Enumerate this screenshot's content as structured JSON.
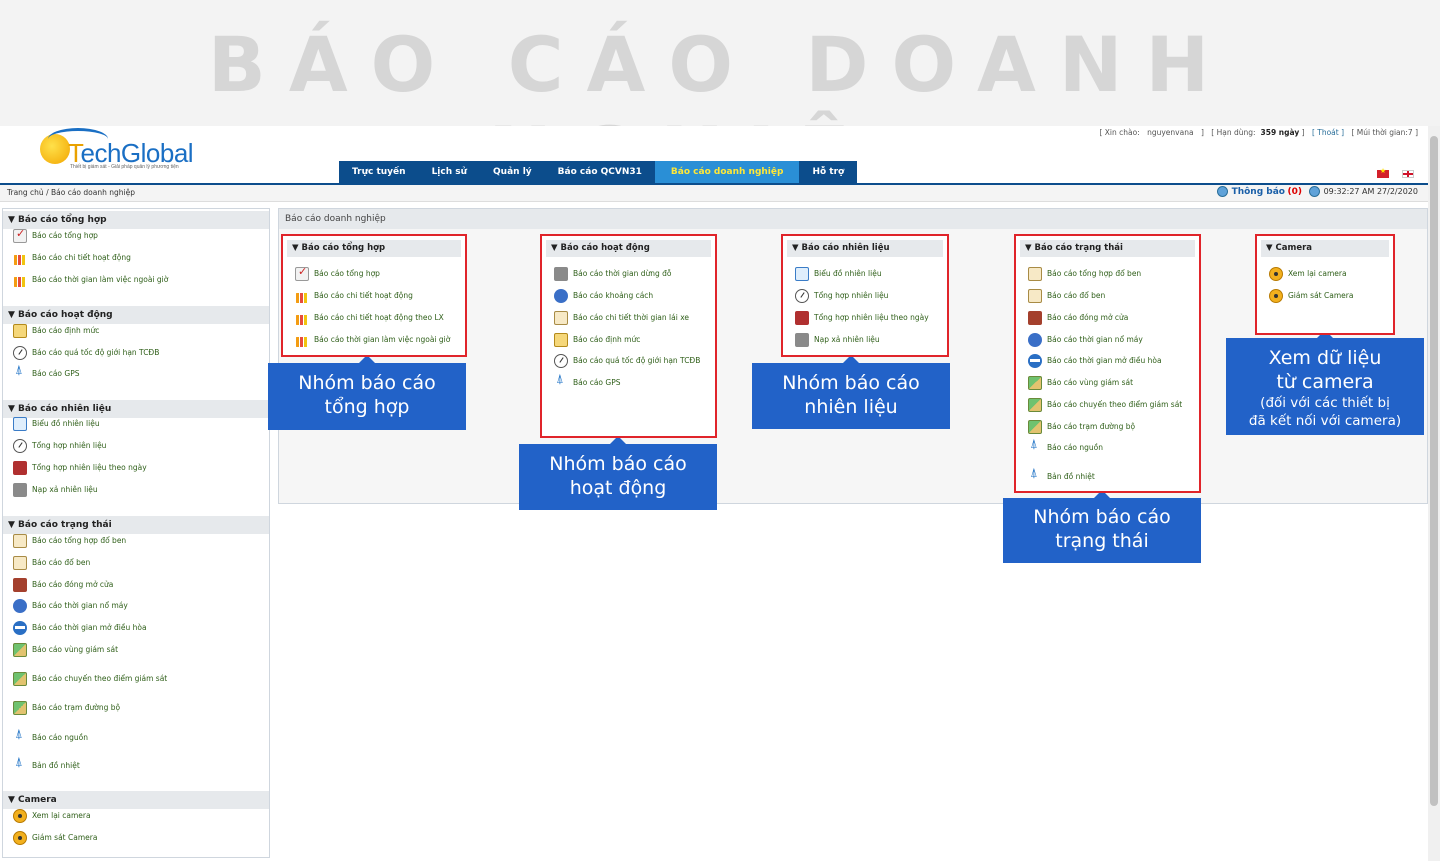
{
  "banner": {
    "title": "BÁO CÁO DOANH NGHIỆP"
  },
  "logo": {
    "brand_a": "T",
    "brand_b": "echGlobal",
    "tagline": "Thiết bị giám sát - Giải pháp quản lý phương tiện"
  },
  "userbar": {
    "greeting_label": "[ Xin chào:",
    "username": "nguyenvana",
    "close1": "]",
    "expiry_label": "[ Hạn dùng:",
    "expiry_value": "359 ngày",
    "close2": "]",
    "logout": "[ Thoát ]",
    "timezone": "[ Múi thời gian:7 ]"
  },
  "nav": {
    "items": [
      "Trực tuyến",
      "Lịch sử",
      "Quản lý",
      "Báo cáo QCVN31",
      "Báo cáo doanh nghiệp",
      "Hỗ trợ"
    ],
    "active": "Báo cáo doanh nghiệp"
  },
  "breadcrumb": "Trang chủ / Báo cáo doanh nghiệp",
  "notice": {
    "label": "Thông báo",
    "count": "(0)",
    "datetime": "09:32:27 AM 27/2/2020"
  },
  "sidebar": {
    "groups": [
      {
        "title": "▼ Báo cáo tổng hợp",
        "items": [
          "Báo cáo tổng hợp",
          "Báo cáo chi tiết hoạt động",
          "Báo cáo thời gian làm việc ngoài giờ"
        ]
      },
      {
        "title": "▼ Báo cáo hoạt động",
        "items": [
          "Báo cáo định mức",
          "Báo cáo quá tốc độ giới hạn TCĐB",
          "Báo cáo GPS"
        ]
      },
      {
        "title": "▼ Báo cáo nhiên liệu",
        "items": [
          "Biểu đồ nhiên liệu",
          "Tổng hợp nhiên liệu",
          "Tổng hợp nhiên liệu theo ngày",
          "Nạp xả nhiên liệu"
        ]
      },
      {
        "title": "▼ Báo cáo trạng thái",
        "items": [
          "Báo cáo tổng hợp đổ ben",
          "Báo cáo đổ ben",
          "Báo cáo đóng mở cửa",
          "Báo cáo thời gian nổ máy",
          "Báo cáo thời gian mở điều hòa",
          "Báo cáo vùng giám sát",
          "Báo cáo chuyến theo điểm giám sát",
          "Báo cáo trạm đường bộ",
          "Báo cáo nguồn",
          "Bản đồ nhiệt"
        ]
      },
      {
        "title": "▼ Camera",
        "items": [
          "Xem lại camera",
          "Giám sát Camera"
        ]
      }
    ]
  },
  "panel": {
    "title": "Báo cáo doanh nghiệp",
    "groups": [
      {
        "title": "▼ Báo cáo tổng hợp",
        "items": [
          "Báo cáo tổng hợp",
          "Báo cáo chi tiết hoạt động",
          "Báo cáo chi tiết hoạt động theo LX",
          "Báo cáo thời gian làm việc ngoài giờ"
        ]
      },
      {
        "title": "▼ Báo cáo hoạt động",
        "items": [
          "Báo cáo thời gian dừng đỗ",
          "Báo cáo khoảng cách",
          "Báo cáo chi tiết thời gian lái xe",
          "Báo cáo định mức",
          "Báo cáo quá tốc độ giới hạn TCĐB",
          "Báo cáo GPS"
        ]
      },
      {
        "title": "▼ Báo cáo nhiên liệu",
        "items": [
          "Biểu đồ nhiên liệu",
          "Tổng hợp nhiên liệu",
          "Tổng hợp nhiên liệu theo ngày",
          "Nạp xả nhiên liệu"
        ]
      },
      {
        "title": "▼ Báo cáo trạng thái",
        "items": [
          "Báo cáo tổng hợp đổ ben",
          "Báo cáo đổ ben",
          "Báo cáo đóng mở cửa",
          "Báo cáo thời gian nổ máy",
          "Báo cáo thời gian mở điều hòa",
          "Báo cáo vùng giám sát",
          "Báo cáo chuyến theo điểm giám sát",
          "Báo cáo trạm đường bộ",
          "Báo cáo nguồn",
          "Bản đồ nhiệt"
        ]
      },
      {
        "title": "▼ Camera",
        "items": [
          "Xem lại camera",
          "Giám sát Camera"
        ]
      }
    ]
  },
  "callouts": {
    "tong_hop": {
      "line1": "Nhóm báo cáo",
      "line2": "tổng hợp"
    },
    "hoat_dong": {
      "line1": "Nhóm báo cáo",
      "line2": "hoạt động"
    },
    "nhien_lieu": {
      "line1": "Nhóm báo cáo",
      "line2": "nhiên liệu"
    },
    "trang_thai": {
      "line1": "Nhóm báo cáo",
      "line2": "trạng thái"
    },
    "camera": {
      "line1": "Xem dữ liệu",
      "line2": "từ camera",
      "line3": "(đối với các thiết bị",
      "line4": "đã kết nối với camera)"
    }
  },
  "colors": {
    "nav_bg": "#0c4d8c",
    "nav_active": "#2a8fd6",
    "callout": "#2262c8",
    "highlight_border": "#e0242a",
    "link_green": "#2f5f19"
  },
  "icons": [
    "check-report-icon",
    "bar-chart-icon",
    "pen-icon",
    "gauge-icon",
    "antenna-icon",
    "line-chart-icon",
    "fuel-pump-icon",
    "truck-icon",
    "document-icon",
    "door-icon",
    "engine-icon",
    "air-conditioner-icon",
    "map-icon",
    "camera-icon"
  ]
}
